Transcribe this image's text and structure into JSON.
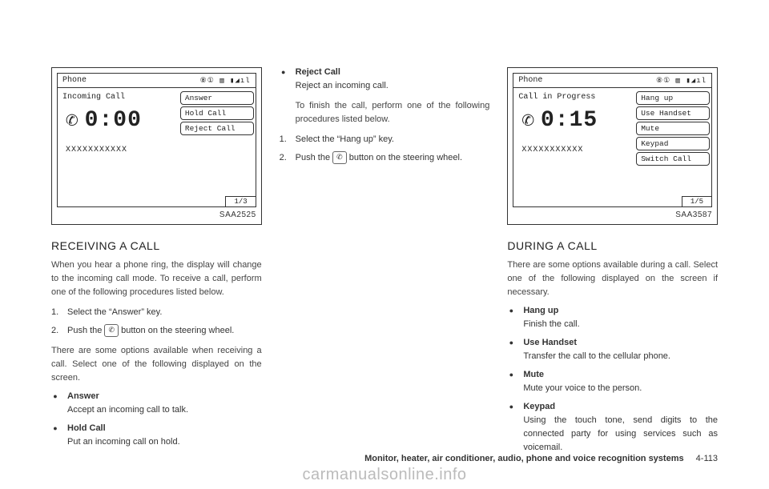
{
  "col1": {
    "figure": {
      "topTitle": "Phone",
      "topIcons": "⑧① ▥ ▮◢ıl",
      "status": "Incoming Call",
      "phoneGlyph": "✆",
      "time": "0:00",
      "xxx": "XXXXXXXXXXX",
      "menu": [
        "Answer",
        "Hold Call",
        "Reject Call"
      ],
      "counter": "1/3",
      "label": "SAA2525"
    },
    "heading": "RECEIVING A CALL",
    "intro": "When you hear a phone ring, the display will change to the incoming call mode. To receive a call, perform one of the following procedures listed below.",
    "steps": [
      "Select the “Answer” key.",
      "Push the   button on the steering wheel."
    ],
    "afterSteps": "There are some options available when receiving a call. Select one of the following displayed on the screen.",
    "bullets": [
      {
        "name": "Answer",
        "desc": "Accept an incoming call to talk."
      },
      {
        "name": "Hold Call",
        "desc": "Put an incoming call on hold."
      }
    ]
  },
  "col2": {
    "bullets": [
      {
        "name": "Reject Call",
        "desc": "Reject an incoming call."
      }
    ],
    "finish": "To finish the call, perform one of the following procedures listed below.",
    "steps": [
      "Select the “Hang up” key.",
      "Push the   button on the steering wheel."
    ]
  },
  "col3": {
    "figure": {
      "topTitle": "Phone",
      "topIcons": "⑧① ▥ ▮◢ıl",
      "status": "Call in Progress",
      "phoneGlyph": "✆",
      "time": "0:15",
      "xxx": "XXXXXXXXXXX",
      "menu": [
        "Hang up",
        "Use Handset",
        "Mute",
        "Keypad",
        "Switch Call"
      ],
      "counter": "1/5",
      "label": "SAA3587"
    },
    "heading": "DURING A CALL",
    "intro": "There are some options available during a call. Select one of the following displayed on the screen if necessary.",
    "bullets": [
      {
        "name": "Hang up",
        "desc": "Finish the call."
      },
      {
        "name": "Use Handset",
        "desc": "Transfer the call to the cellular phone."
      },
      {
        "name": "Mute",
        "desc": "Mute your voice to the person."
      },
      {
        "name": "Keypad",
        "desc": "Using the touch tone, send digits to the connected party for using services such as voicemail."
      }
    ]
  },
  "footer": {
    "section": "Monitor, heater, air conditioner, audio, phone and voice recognition systems",
    "page": "4-113"
  },
  "watermark": "carmanualsonline.info",
  "phoneBtnGlyph": "✆"
}
